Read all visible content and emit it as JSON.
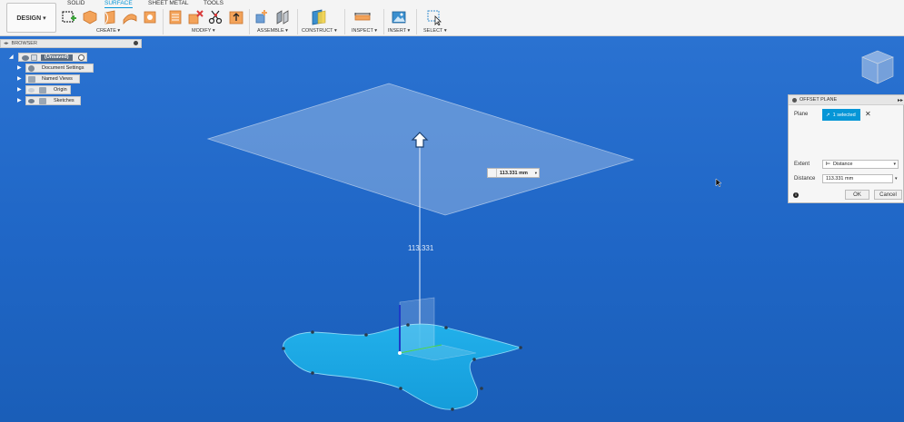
{
  "toolbar": {
    "design_label": "DESIGN ▾",
    "tabs": [
      "SOLID",
      "SURFACE",
      "SHEET METAL",
      "TOOLS"
    ],
    "groups": {
      "create": "CREATE ▾",
      "modify": "MODIFY ▾",
      "assemble": "ASSEMBLE ▾",
      "construct": "CONSTRUCT ▾",
      "inspect": "INSPECT ▾",
      "insert": "INSERT ▾",
      "select": "SELECT ▾"
    }
  },
  "browser": {
    "title": "BROWSER",
    "root": "(Unsaved)",
    "items": [
      "Document Settings",
      "Named Views",
      "Origin",
      "Sketches"
    ]
  },
  "dialog": {
    "title": "OFFSET PLANE",
    "plane_label": "Plane",
    "plane_value": "1 selected",
    "extent_label": "Extent",
    "extent_value": "Distance",
    "distance_label": "Distance",
    "distance_value": "113.331 mm",
    "ok_label": "OK",
    "cancel_label": "Cancel"
  },
  "viewport": {
    "dimension_input": "113.331 mm",
    "dimension_label": "113.331"
  },
  "colors": {
    "accent": "#0696d7",
    "background_top": "#2a72d1",
    "background_bottom": "#1a5eb8",
    "sketch_fill": "#19aee8",
    "plane_fill": "#a9c3e6"
  },
  "icons": {
    "tree_item": "eye-icon",
    "settings": "gear-icon",
    "info": "info-icon",
    "select_cursor": "cursor-icon",
    "manipulator": "arrow-up-icon"
  }
}
